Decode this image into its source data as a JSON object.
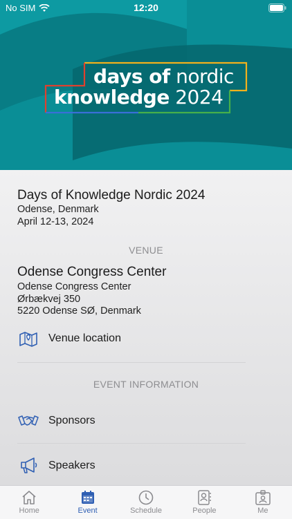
{
  "status_bar": {
    "carrier": "No SIM",
    "time": "12:20"
  },
  "banner": {
    "line1_bold": "days of",
    "line1_thin": "nordic",
    "line2_bold": "knowledge",
    "line2_thin": "2024"
  },
  "event": {
    "title": "Days of Knowledge Nordic 2024",
    "location": "Odense, Denmark",
    "dates": "April 12-13, 2024"
  },
  "venue_section": {
    "header": "VENUE",
    "name": "Odense Congress Center",
    "address_lines": [
      "Odense Congress Center",
      "Ørbækvej 350",
      "5220 Odense SØ, Denmark"
    ],
    "location_link": "Venue location"
  },
  "event_info_section": {
    "header": "EVENT INFORMATION",
    "items": [
      {
        "label": "Sponsors",
        "icon": "handshake-icon"
      },
      {
        "label": "Speakers",
        "icon": "megaphone-icon"
      }
    ]
  },
  "tabs": [
    {
      "label": "Home",
      "icon": "home-icon"
    },
    {
      "label": "Event",
      "icon": "calendar-icon",
      "active": true
    },
    {
      "label": "Schedule",
      "icon": "clock-icon"
    },
    {
      "label": "People",
      "icon": "contacts-icon"
    },
    {
      "label": "Me",
      "icon": "badge-icon"
    }
  ],
  "colors": {
    "accent": "#2f5fb3",
    "banner_bg": "#0a8e96"
  }
}
